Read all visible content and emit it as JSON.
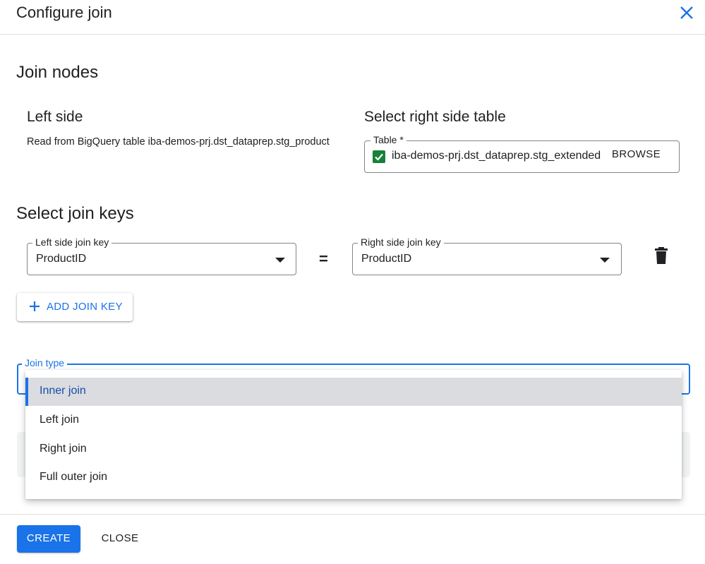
{
  "dialog": {
    "title": "Configure join",
    "close_icon": "close-icon"
  },
  "join_nodes": {
    "heading": "Join nodes",
    "left": {
      "heading": "Left side",
      "description": "Read from BigQuery table iba-demos-prj.dst_dataprep.stg_product"
    },
    "right": {
      "heading": "Select right side table",
      "table_label": "Table *",
      "table_value": "iba-demos-prj.dst_dataprep.stg_extended",
      "browse_label": "BROWSE",
      "check_color": "#188038"
    }
  },
  "join_keys": {
    "heading": "Select join keys",
    "left_label": "Left side join key",
    "left_value": "ProductID",
    "equals": "=",
    "right_label": "Right side join key",
    "right_value": "ProductID",
    "delete_icon": "trash-icon",
    "add_label": "ADD JOIN KEY"
  },
  "join_type": {
    "label": "Join type",
    "options": [
      "Inner join",
      "Left join",
      "Right join",
      "Full outer join"
    ],
    "selected": "Inner join"
  },
  "footer": {
    "create_label": "CREATE",
    "close_label": "CLOSE"
  },
  "colors": {
    "primary": "#1a73e8",
    "selected_text": "#174ea6",
    "selected_bg": "#dadce0"
  }
}
